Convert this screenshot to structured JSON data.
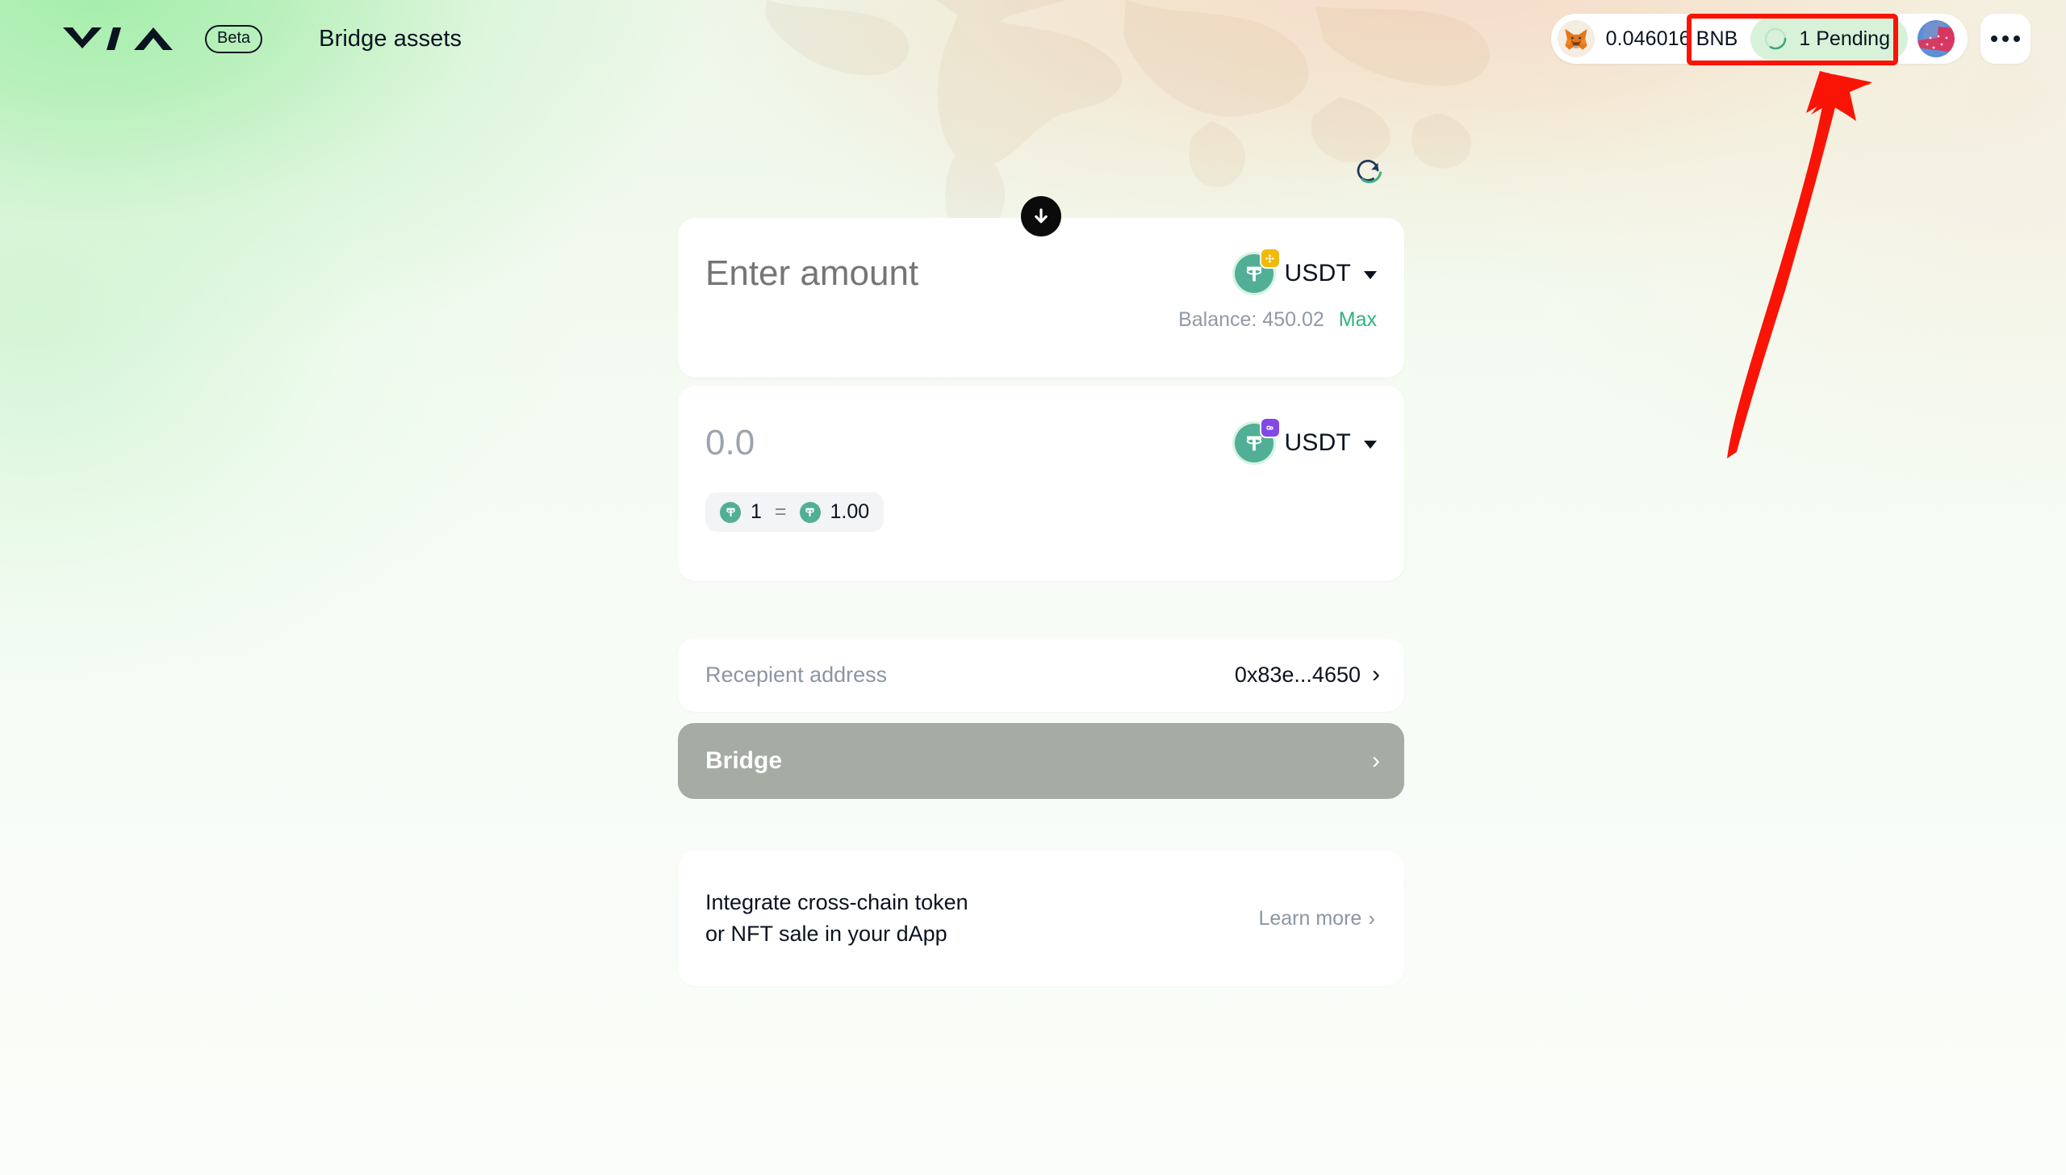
{
  "header": {
    "logo_name": "via-logo",
    "beta_label": "Beta",
    "page_title": "Bridge assets",
    "wallet": {
      "icon_name": "metamask-fox-icon",
      "balance": "0.046016 BNB"
    },
    "pending": {
      "label": "1 Pending",
      "spinner_name": "loading-spinner-icon",
      "bg_color": "#d7f2d8"
    },
    "avatar_name": "account-avatar",
    "more_menu_label": "..."
  },
  "refresh": {
    "icon_name": "refresh-icon",
    "arc_color": "#3fae82",
    "ring_color": "#1e3a5f"
  },
  "from_card": {
    "amount_placeholder": "Enter amount",
    "amount_value": "",
    "token_symbol": "USDT",
    "chain_badge": "bnb-chain-badge",
    "chain_badge_color": "#f0b90b",
    "balance_label": "Balance: 450.02",
    "max_label": "Max"
  },
  "swap": {
    "icon_name": "arrow-down-icon"
  },
  "to_card": {
    "amount_value": "0.0",
    "token_symbol": "USDT",
    "chain_badge": "polygon-chain-badge",
    "chain_badge_color": "#8247e5",
    "rate": {
      "left_amount": "1",
      "equals": "=",
      "right_amount": "1.00"
    }
  },
  "recipient": {
    "label": "Recepient address",
    "value": "0x83e...4650"
  },
  "bridge_button": {
    "label": "Bridge",
    "disabled_color": "#a4aca4"
  },
  "promo": {
    "line1": "Integrate cross-chain token",
    "line2": "or NFT sale in your dApp",
    "cta": "Learn more"
  },
  "annotation": {
    "highlight_color": "#fa1405",
    "target": "1 Pending"
  },
  "colors": {
    "accent_green": "#2fb37e",
    "tether_green": "#50af95",
    "text_primary": "#0b1320",
    "text_muted": "#9099a8"
  }
}
